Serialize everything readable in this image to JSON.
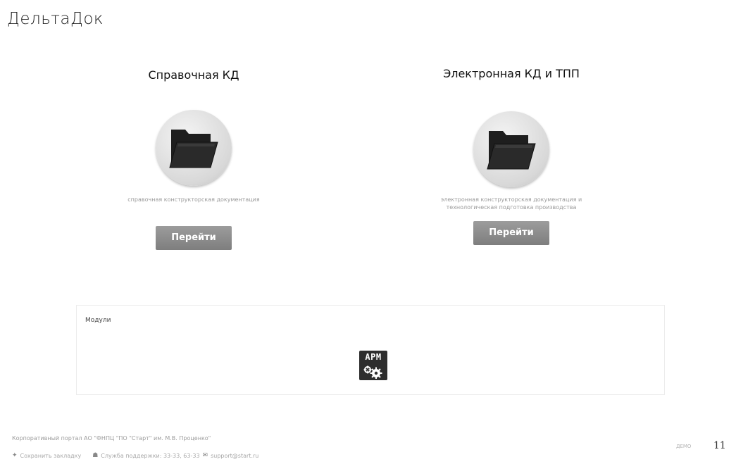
{
  "header": {
    "logo": "ДельтаДок"
  },
  "cards": [
    {
      "title": "Справочная КД",
      "description": "справочная конструкторская документация",
      "button_label": "Перейти"
    },
    {
      "title": "Электронная КД и ТПП",
      "description": "электронная конструкторская документация и технологическая подготовка производства",
      "button_label": "Перейти"
    }
  ],
  "modules": {
    "title": "Модули",
    "items": [
      {
        "label": "АРМ",
        "icon": "gears-icon"
      }
    ]
  },
  "footer": {
    "portal": "Корпоративный портал АО \"ФНПЦ \"ПО \"Старт\" им. М.В. Проценко\"",
    "save_bookmark": "Сохранить закладку",
    "support": "Служба поддержки: 33-33, 63-33",
    "email": "support@start.ru",
    "demo": "ДЕМО",
    "page_number": "11"
  }
}
